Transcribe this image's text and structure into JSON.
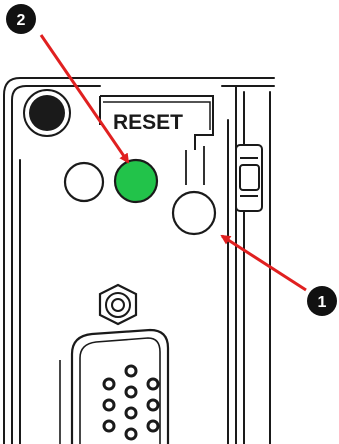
{
  "panel": {
    "reset_label": "RESET"
  },
  "callouts": [
    {
      "number": "1",
      "target": "reset-button"
    },
    {
      "number": "2",
      "target": "status-led-green"
    }
  ],
  "colors": {
    "led_on": "#22c34a",
    "led_off": "#ffffff",
    "outline": "#1a1a1a",
    "callout_arrow": "#e02020",
    "badge_fill": "#111111",
    "badge_text": "#ffffff"
  },
  "leds": [
    {
      "state": "off"
    },
    {
      "state": "on"
    }
  ]
}
